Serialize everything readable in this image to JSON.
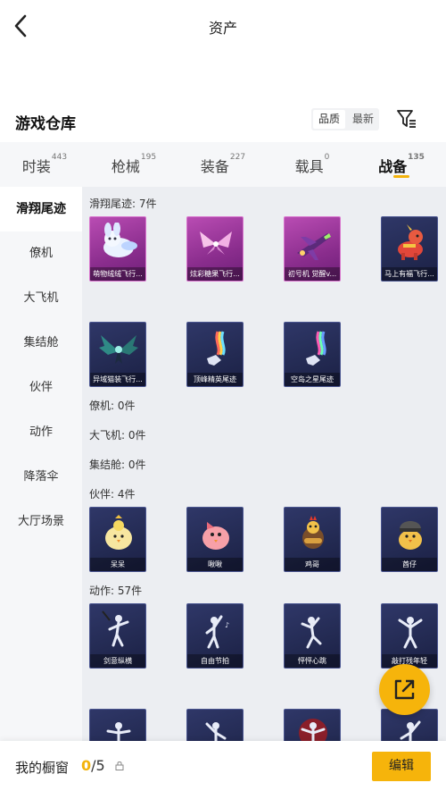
{
  "header": {
    "title": "资产"
  },
  "section": {
    "title": "游戏仓库",
    "sort": {
      "quality": "品质",
      "newest": "最新"
    }
  },
  "categories": [
    {
      "label": "时装",
      "count": "443"
    },
    {
      "label": "枪械",
      "count": "195"
    },
    {
      "label": "装备",
      "count": "227"
    },
    {
      "label": "载具",
      "count": "0"
    },
    {
      "label": "战备",
      "count": "135"
    }
  ],
  "sidebar": [
    {
      "label": "滑翔尾迹"
    },
    {
      "label": "僚机"
    },
    {
      "label": "大飞机"
    },
    {
      "label": "集结舱"
    },
    {
      "label": "伙伴"
    },
    {
      "label": "动作"
    },
    {
      "label": "降落伞"
    },
    {
      "label": "大厅场景"
    }
  ],
  "groups": {
    "trail": "滑翔尾迹: 7件",
    "wingman": "僚机: 0件",
    "plane": "大飞机: 0件",
    "pod": "集结舱: 0件",
    "partner": "伙伴: 4件",
    "action": "动作: 57件"
  },
  "trail_items": [
    {
      "name": "萌物绒绒飞行...",
      "icon": "plush-rabbit-icon"
    },
    {
      "name": "炫彩糖果飞行...",
      "icon": "candy-wings-icon"
    },
    {
      "name": "初号机 觉醒v...",
      "icon": "jet-fighter-icon"
    },
    {
      "name": "马上有福飞行...",
      "icon": "fortune-horse-icon"
    },
    {
      "name": "异域猫装飞行...",
      "icon": "dragon-wings-icon"
    },
    {
      "name": "顶峰精英尾迹",
      "icon": "rainbow-trail-icon"
    },
    {
      "name": "空岛之星尾迹",
      "icon": "star-trail-icon"
    }
  ],
  "partner_items": [
    {
      "name": "呆呆",
      "icon": "yellow-chick-icon"
    },
    {
      "name": "啾啾",
      "icon": "pink-chick-icon"
    },
    {
      "name": "鸡哥",
      "icon": "guitar-chicken-icon"
    },
    {
      "name": "酋仔",
      "icon": "armored-chick-icon"
    }
  ],
  "action_items": [
    {
      "name": "剑意纵横",
      "icon": "sword-dance-icon"
    },
    {
      "name": "自由节拍",
      "icon": "free-beat-icon"
    },
    {
      "name": "怦怦心跳",
      "icon": "heartbeat-dance-icon"
    },
    {
      "name": "敲打残年轻",
      "icon": "drum-dance-icon"
    }
  ],
  "bottom": {
    "label": "我的橱窗",
    "used": "0",
    "total": "/5",
    "edit": "编辑"
  }
}
